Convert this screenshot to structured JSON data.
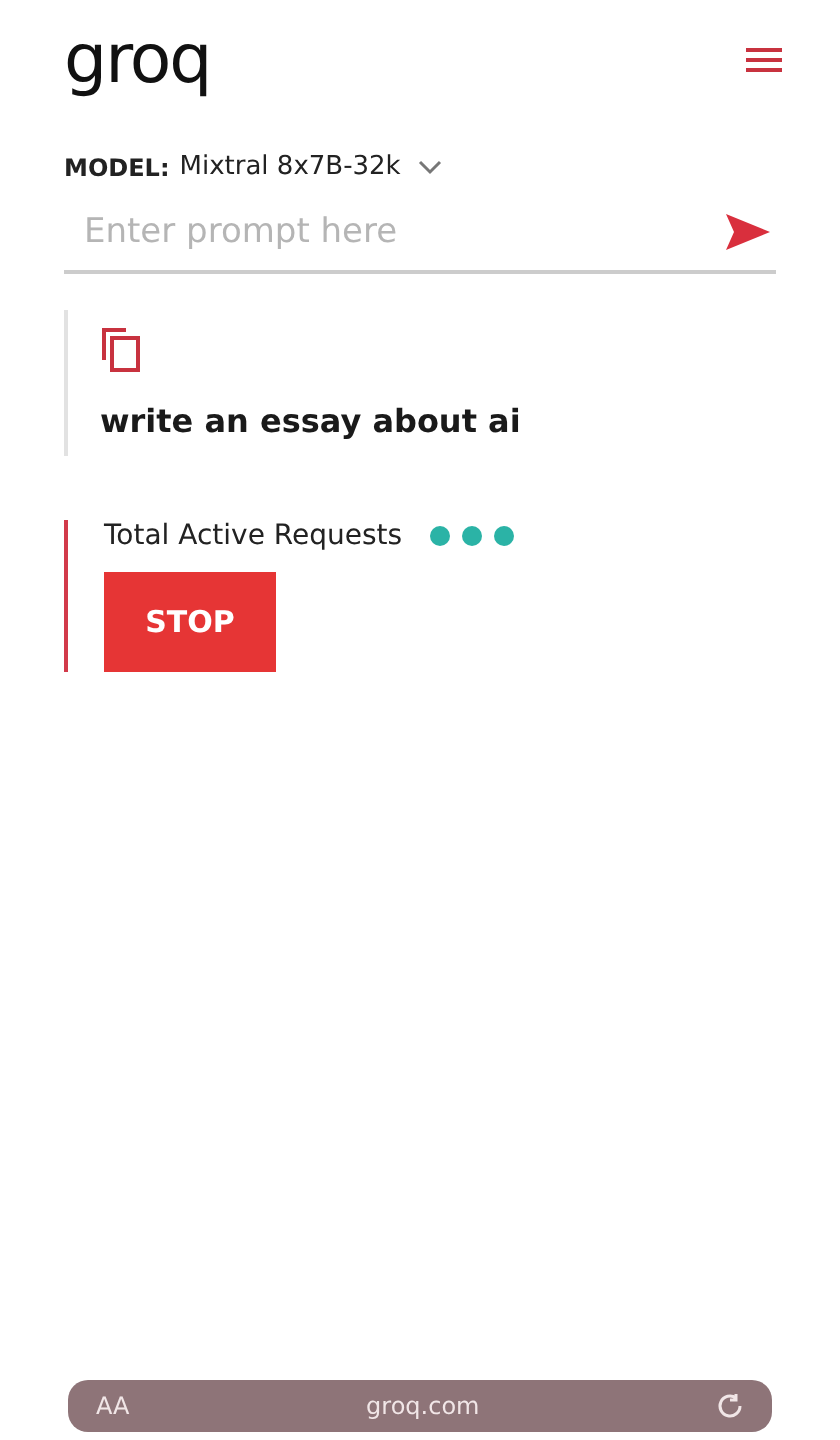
{
  "header": {
    "logo": "groq"
  },
  "model": {
    "label": "MODEL:",
    "value": "Mixtral 8x7B-32k"
  },
  "prompt": {
    "placeholder": "Enter prompt here"
  },
  "message": {
    "text": "write an essay about ai"
  },
  "requests": {
    "label": "Total Active Requests",
    "button": "STOP"
  },
  "browser_bar": {
    "text_size": "AA",
    "url": "groq.com"
  }
}
